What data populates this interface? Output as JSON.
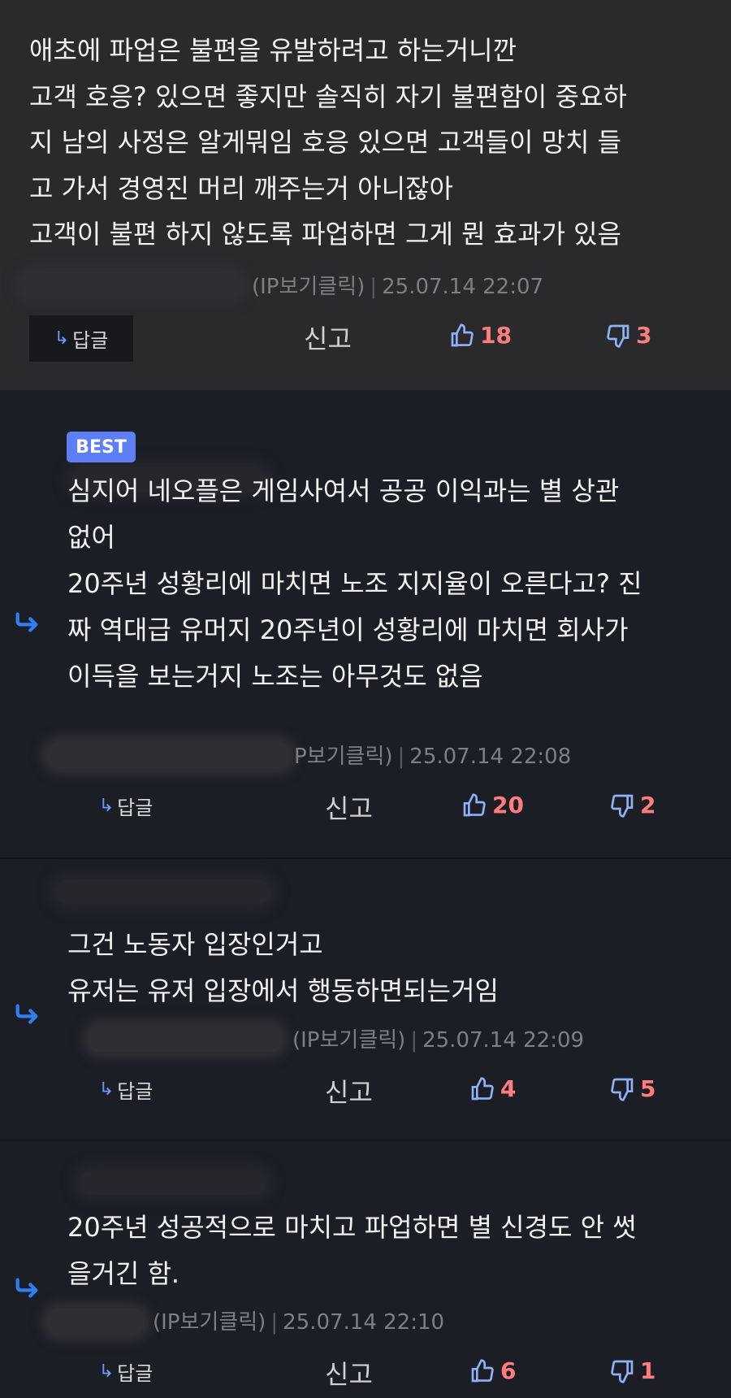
{
  "comments": [
    {
      "text": "애초에 파업은 불편을 유발하려고 하는거니깐\n고객 호응? 있으면 좋지만 솔직히 자기 불편함이 중요하\n지 남의 사정은 알게뭐임 호응 있으면 고객들이 망치 들\n고 가서 경영진 머리 깨주는거 아니잖아\n고객이 불편 하지 않도록 파업하면 그게 뭔 효과가 있음",
      "ip_label": "(IP보기클릭)",
      "timestamp": "25.07.14 22:07",
      "reply_label": "답글",
      "report_label": "신고",
      "upvotes": "18",
      "downvotes": "3"
    },
    {
      "badge": "BEST",
      "text": "심지어 네오플은 게임사여서 공공 이익과는 별 상관\n없어\n20주년 성황리에 마치면 노조 지지율이 오른다고? 진\n짜 역대급 유머지 20주년이 성황리에 마치면 회사가\n이득을 보는거지 노조는 아무것도 없음",
      "ip_label": "P보기클릭)",
      "timestamp": "25.07.14 22:08",
      "reply_label": "답글",
      "report_label": "신고",
      "upvotes": "20",
      "downvotes": "2"
    },
    {
      "text": "그건 노동자 입장인거고\n유저는 유저 입장에서 행동하면되는거임",
      "ip_label": "(IP보기클릭)",
      "timestamp": "25.07.14 22:09",
      "reply_label": "답글",
      "report_label": "신고",
      "upvotes": "4",
      "downvotes": "5"
    },
    {
      "text": "20주년 성공적으로 마치고 파업하면 별 신경도 안 썻\n을거긴 함.",
      "ip_label": "(IP보기클릭)",
      "timestamp": "25.07.14 22:10",
      "reply_label": "답글",
      "report_label": "신고",
      "upvotes": "6",
      "downvotes": "1"
    }
  ],
  "icons": {
    "reply_arrow": "reply-arrow-icon",
    "upvote": "thumbs-up-icon",
    "downvote": "thumbs-down-icon",
    "nested_reply": "nested-reply-arrow-icon"
  },
  "colors": {
    "page_bg": "#1b1e25",
    "top_comment_bg": "#2a2a2c",
    "badge_bg": "#5d7ef5",
    "accent_blue": "#2f7ff0",
    "vote_count": "#ff7d7d"
  }
}
